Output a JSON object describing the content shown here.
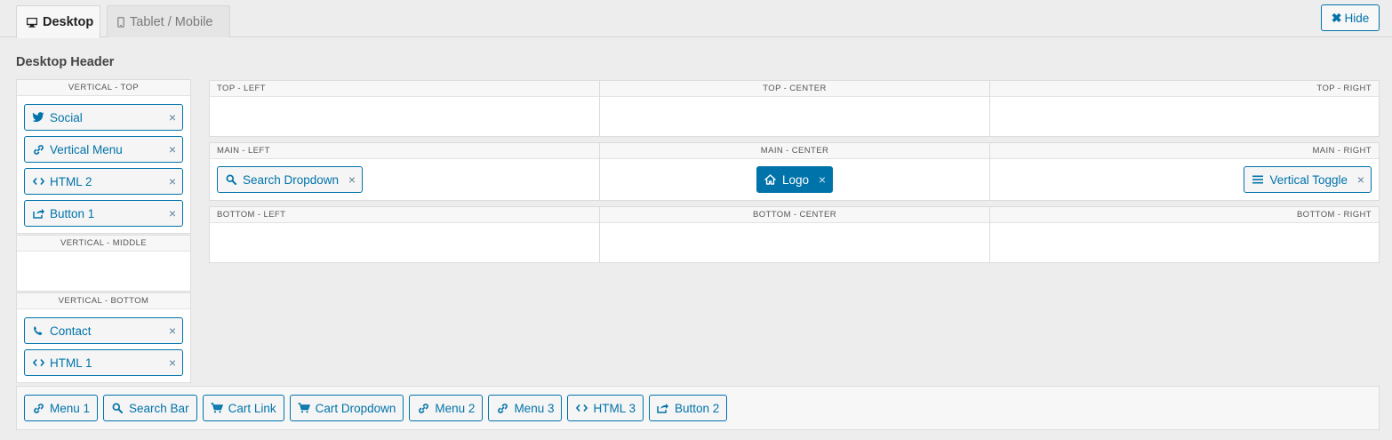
{
  "tabs": [
    {
      "label": "Desktop",
      "icon": "desktop-icon",
      "active": true
    },
    {
      "label": "Tablet / Mobile",
      "icon": "mobile-icon",
      "active": false
    }
  ],
  "hide_button": {
    "label": "Hide",
    "icon": "close-icon"
  },
  "section_title": "Desktop Header",
  "vertical": {
    "top": {
      "title": "VERTICAL - TOP",
      "items": [
        {
          "label": "Social",
          "icon": "twitter-icon"
        },
        {
          "label": "Vertical Menu",
          "icon": "link-icon"
        },
        {
          "label": "HTML 2",
          "icon": "code-icon"
        },
        {
          "label": "Button 1",
          "icon": "share-icon"
        }
      ]
    },
    "middle": {
      "title": "VERTICAL - MIDDLE",
      "items": []
    },
    "bottom": {
      "title": "VERTICAL - BOTTOM",
      "items": [
        {
          "label": "Contact",
          "icon": "phone-icon"
        },
        {
          "label": "HTML 1",
          "icon": "code-icon"
        }
      ]
    }
  },
  "rows": {
    "top": {
      "left": "TOP - LEFT",
      "center": "TOP - CENTER",
      "right": "TOP - RIGHT"
    },
    "main": {
      "left": "MAIN - LEFT",
      "center": "MAIN - CENTER",
      "right": "MAIN - RIGHT"
    },
    "bottom": {
      "left": "BOTTOM - LEFT",
      "center": "BOTTOM - CENTER",
      "right": "BOTTOM - RIGHT"
    }
  },
  "placed": {
    "main_left": {
      "label": "Search Dropdown",
      "icon": "search-icon"
    },
    "main_center": {
      "label": "Logo",
      "icon": "home-icon"
    },
    "main_right": {
      "label": "Vertical Toggle",
      "icon": "menu-icon"
    }
  },
  "available": [
    {
      "label": "Menu 1",
      "icon": "link-icon"
    },
    {
      "label": "Search Bar",
      "icon": "search-icon"
    },
    {
      "label": "Cart Link",
      "icon": "cart-icon"
    },
    {
      "label": "Cart Dropdown",
      "icon": "cart-icon"
    },
    {
      "label": "Menu 2",
      "icon": "link-icon"
    },
    {
      "label": "Menu 3",
      "icon": "link-icon"
    },
    {
      "label": "HTML 3",
      "icon": "code-icon"
    },
    {
      "label": "Button 2",
      "icon": "share-icon"
    }
  ],
  "remove_glyph": "×",
  "colors": {
    "accent": "#0073aa",
    "background": "#ededed",
    "panel": "#ffffff"
  }
}
